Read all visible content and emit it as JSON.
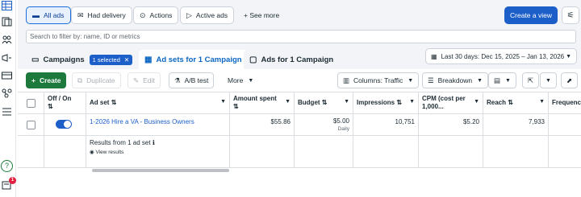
{
  "colors": {
    "accent": "#1d5fc9",
    "create_green": "#1e7a3c",
    "badge_red": "#e41e3f"
  },
  "sidebar": {
    "icons": [
      "table-icon",
      "layers-icon",
      "people-icon",
      "megaphone-icon",
      "billing-icon",
      "graph-icon",
      "menu-icon",
      "help-icon",
      "notifications-icon"
    ],
    "help_glyph": "?",
    "notification_count": "1"
  },
  "filters": {
    "all_ads": "All ads",
    "had_delivery": "Had delivery",
    "actions": "Actions",
    "active_ads": "Active ads",
    "see_more": "See more",
    "create_view": "Create a view"
  },
  "search": {
    "placeholder": "Search to filter by: name, ID or metrics"
  },
  "tabs": {
    "campaigns": "Campaigns",
    "selected": "1 selected",
    "ad_sets": "Ad sets for 1 Campaign",
    "ads": "Ads for 1 Campaign"
  },
  "date_range": "Last 30 days: Dec 15, 2025 – Jan 13, 2026",
  "toolbar": {
    "create": "Create",
    "duplicate": "Duplicate",
    "edit": "Edit",
    "ab_test": "A/B test",
    "more": "More",
    "columns": "Columns: Traffic",
    "breakdown": "Breakdown"
  },
  "table": {
    "headers": {
      "off_on": "Off / On",
      "ad_set": "Ad set",
      "amount_spent": "Amount spent",
      "budget": "Budget",
      "impressions": "Impressions",
      "cpm": "CPM (cost per 1,000...",
      "reach": "Reach",
      "frequency": "Frequenc"
    },
    "row": {
      "name": "1-2026 Hire a VA - Business Owners",
      "amount_spent": "$55.86",
      "budget": "$5.00",
      "budget_period": "Daily",
      "impressions": "10,751",
      "cpm": "$5.20",
      "reach": "7,933",
      "delivery_on": true
    },
    "summary": {
      "label": "Results from 1 ad set",
      "view_results": "View results"
    }
  }
}
